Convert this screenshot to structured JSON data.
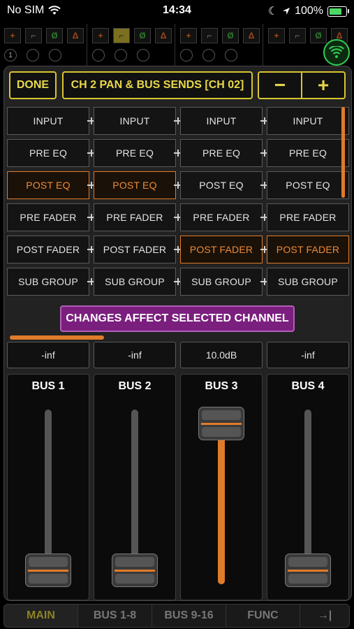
{
  "status_bar": {
    "carrier": "No SIM",
    "time": "14:34",
    "battery_percent": "100%"
  },
  "background_strip": {
    "channel_numbers": [
      "1"
    ]
  },
  "toolbar": {
    "done_label": "DONE",
    "title": "CH 2 PAN & BUS SENDS [CH 02]",
    "minus_label": "−",
    "plus_label": "+"
  },
  "send_points": {
    "rows": [
      "INPUT",
      "PRE EQ",
      "POST EQ",
      "PRE FADER",
      "POST FADER",
      "SUB GROUP"
    ],
    "selected_row_per_bus": [
      "POST EQ",
      "POST EQ",
      "POST FADER",
      "POST FADER"
    ]
  },
  "notice": "CHANGES AFFECT SELECTED CHANNEL",
  "buses": [
    {
      "label": "BUS 1",
      "level": "-inf",
      "fader_fraction": 0.0
    },
    {
      "label": "BUS 2",
      "level": "-inf",
      "fader_fraction": 0.0
    },
    {
      "label": "BUS 3",
      "level": "10.0dB",
      "fader_fraction": 1.0
    },
    {
      "label": "BUS 4",
      "level": "-inf",
      "fader_fraction": 0.0
    }
  ],
  "tabs": [
    {
      "label": "MAIN",
      "selected": true
    },
    {
      "label": "BUS 1-8",
      "selected": false
    },
    {
      "label": "BUS 9-16",
      "selected": false
    },
    {
      "label": "FUNC",
      "selected": false
    },
    {
      "label": "→|",
      "selected": false
    }
  ],
  "colors": {
    "accent_orange": "#e07b2a",
    "accent_yellow": "#d8c52f",
    "notice_purple": "#7a1f7e",
    "wifi_green": "#33cc55"
  }
}
